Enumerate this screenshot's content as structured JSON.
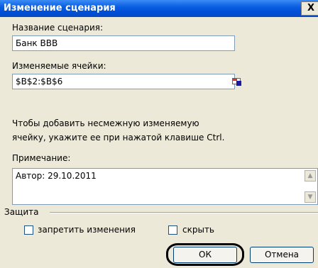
{
  "window": {
    "title": "Изменение сценария",
    "close_glyph": "X"
  },
  "scenario_name": {
    "label": "Название сценария:",
    "value": "Банк ВВВ"
  },
  "changing_cells": {
    "label": "Изменяемые ячейки:",
    "value": "$B$2:$B$6",
    "picker_icon": "range-select-icon"
  },
  "hint": {
    "line1": "Чтобы добавить несмежную изменяемую",
    "line2": "ячейку, укажите ее при нажатой клавише Ctrl."
  },
  "comment": {
    "label": "Примечание:",
    "value": "Автор: 29.10.2011"
  },
  "protection": {
    "group_label": "Защита",
    "prevent_changes": {
      "label": "запретить изменения",
      "checked": false
    },
    "hide": {
      "label": "скрыть",
      "checked": false
    }
  },
  "buttons": {
    "ok": "ОК",
    "cancel": "Отмена"
  }
}
